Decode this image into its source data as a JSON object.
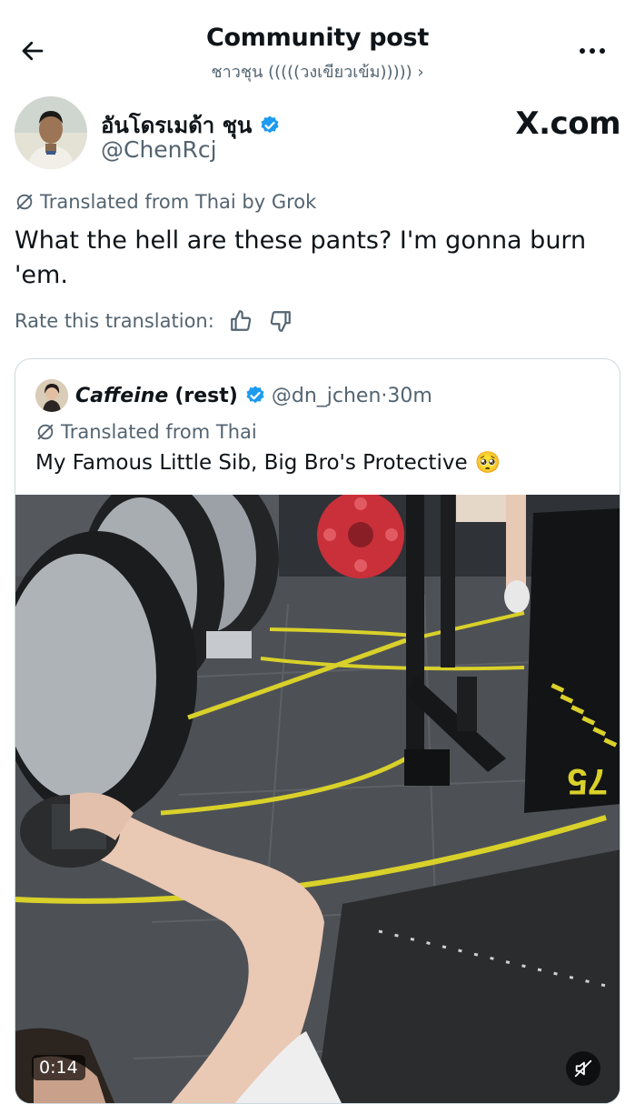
{
  "header": {
    "title": "Community post",
    "subtitle": "ชาวชุน (((((วงเขียวเข้ม))))) ›"
  },
  "author": {
    "name": "อันโดรเมด้า ชุน",
    "handle": "@ChenRcj",
    "verified": true,
    "site": "X.com"
  },
  "translation": {
    "note": "Translated from Thai by Grok",
    "text": "What the hell are these pants? I'm gonna burn 'em.",
    "rate_label": "Rate this translation:"
  },
  "quote": {
    "name_main": "Caffeine",
    "name_rest": "(rest)",
    "verified": true,
    "handle": "@dn_jchen",
    "separator": "·",
    "time": "30m",
    "translation_note": "Translated from Thai",
    "text": "My Famous Little Sib, Big Bro's Protective",
    "emoji": "🥺",
    "video": {
      "duration": "0:14",
      "muted": true
    }
  },
  "colors": {
    "verified_blue": "#1d9bf0",
    "secondary_text": "#536471",
    "border": "#cfd9de",
    "gym_floor_line": "#d9d12a"
  },
  "icons": [
    "back-arrow-icon",
    "more-icon",
    "verified-icon",
    "translate-icon",
    "thumbs-up-icon",
    "thumbs-down-icon",
    "mute-icon"
  ]
}
